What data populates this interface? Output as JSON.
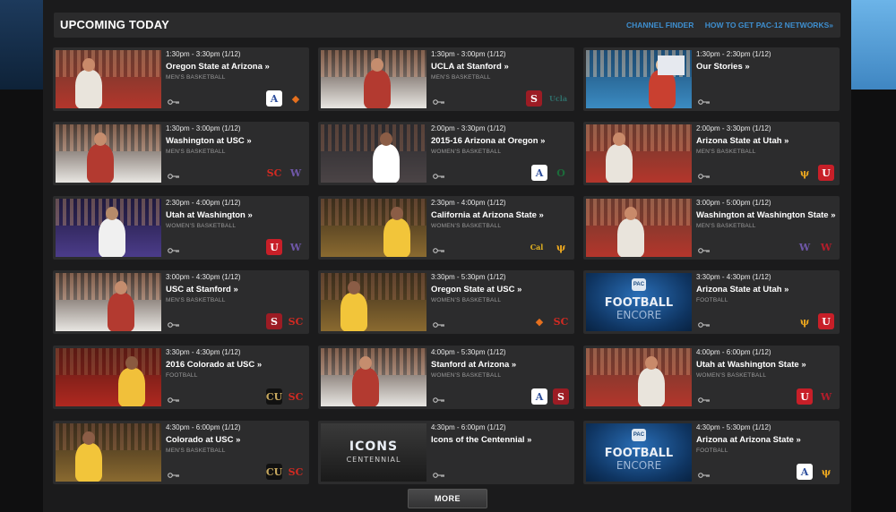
{
  "header": {
    "title": "UPCOMING TODAY",
    "link_channel_finder": "CHANNEL FINDER",
    "link_how_to_get": "HOW TO GET PAC-12 NETWORKS»"
  },
  "more_label": "MORE",
  "cards": [
    {
      "time": "1:30pm - 3:30pm (1/12)",
      "title": "Oregon State at Arizona »",
      "sport": "MEN'S BASKETBALL",
      "logos": [
        "arizona-logo",
        "oregon-state-logo"
      ],
      "thumb": "basketball-red"
    },
    {
      "time": "1:30pm - 3:00pm (1/12)",
      "title": "UCLA at Stanford »",
      "sport": "MEN'S BASKETBALL",
      "logos": [
        "stanford-logo",
        "ucla-logo"
      ],
      "thumb": "basketball-white"
    },
    {
      "time": "1:30pm - 2:30pm (1/12)",
      "title": "Our Stories »",
      "sport": "",
      "logos": [],
      "thumb": "studio"
    },
    {
      "time": "1:30pm - 3:00pm (1/12)",
      "title": "Washington at USC »",
      "sport": "MEN'S BASKETBALL",
      "logos": [
        "usc-logo",
        "washington-logo"
      ],
      "thumb": "basketball-white"
    },
    {
      "time": "2:00pm - 3:30pm (1/12)",
      "title": "2015-16 Arizona at Oregon »",
      "sport": "WOMEN'S BASKETBALL",
      "logos": [
        "arizona-logo",
        "oregon-logo"
      ],
      "thumb": "basketball-dark"
    },
    {
      "time": "2:00pm - 3:30pm (1/12)",
      "title": "Arizona State at Utah »",
      "sport": "MEN'S BASKETBALL",
      "logos": [
        "arizona-state-logo",
        "utah-logo"
      ],
      "thumb": "basketball-red"
    },
    {
      "time": "2:30pm - 4:00pm (1/12)",
      "title": "Utah at Washington »",
      "sport": "WOMEN'S BASKETBALL",
      "logos": [
        "utah-logo",
        "washington-logo"
      ],
      "thumb": "basketball-purple"
    },
    {
      "time": "2:30pm - 4:00pm (1/12)",
      "title": "California at Arizona State »",
      "sport": "WOMEN'S BASKETBALL",
      "logos": [
        "california-logo",
        "arizona-state-logo"
      ],
      "thumb": "basketball-gold"
    },
    {
      "time": "3:00pm - 5:00pm (1/12)",
      "title": "Washington at Washington State »",
      "sport": "MEN'S BASKETBALL",
      "logos": [
        "washington-logo",
        "washington-state-logo"
      ],
      "thumb": "basketball-red"
    },
    {
      "time": "3:00pm - 4:30pm (1/12)",
      "title": "USC at Stanford »",
      "sport": "MEN'S BASKETBALL",
      "logos": [
        "stanford-logo",
        "usc-logo"
      ],
      "thumb": "basketball-white"
    },
    {
      "time": "3:30pm - 5:30pm (1/12)",
      "title": "Oregon State at USC »",
      "sport": "WOMEN'S BASKETBALL",
      "logos": [
        "oregon-state-logo",
        "usc-logo"
      ],
      "thumb": "basketball-gold"
    },
    {
      "time": "3:30pm - 4:30pm (1/12)",
      "title": "Arizona State at Utah »",
      "sport": "FOOTBALL",
      "logos": [
        "arizona-state-logo",
        "utah-logo"
      ],
      "thumb": "football-encore"
    },
    {
      "time": "3:30pm - 4:30pm (1/12)",
      "title": "2016 Colorado at USC »",
      "sport": "FOOTBALL",
      "logos": [
        "colorado-logo",
        "usc-logo"
      ],
      "thumb": "football-red"
    },
    {
      "time": "4:00pm - 5:30pm (1/12)",
      "title": "Stanford at Arizona »",
      "sport": "WOMEN'S BASKETBALL",
      "logos": [
        "arizona-logo",
        "stanford-logo"
      ],
      "thumb": "basketball-white"
    },
    {
      "time": "4:00pm - 6:00pm (1/12)",
      "title": "Utah at Washington State »",
      "sport": "WOMEN'S BASKETBALL",
      "logos": [
        "utah-logo",
        "washington-state-logo"
      ],
      "thumb": "basketball-red"
    },
    {
      "time": "4:30pm - 6:00pm (1/12)",
      "title": "Colorado at USC »",
      "sport": "MEN'S BASKETBALL",
      "logos": [
        "colorado-logo",
        "usc-logo"
      ],
      "thumb": "basketball-gold"
    },
    {
      "time": "4:30pm - 6:00pm (1/12)",
      "title": "Icons of the Centennial »",
      "sport": "",
      "logos": [],
      "thumb": "icons-centennial"
    },
    {
      "time": "4:30pm - 5:30pm (1/12)",
      "title": "Arizona at Arizona State »",
      "sport": "FOOTBALL",
      "logos": [
        "arizona-logo",
        "arizona-state-logo"
      ],
      "thumb": "football-encore"
    }
  ],
  "logo_glyphs": {
    "arizona-logo": {
      "text": "A",
      "color": "#2b4d9c",
      "bg": "#ffffff"
    },
    "oregon-state-logo": {
      "text": "◆",
      "color": "#e6701e",
      "bg": "transparent"
    },
    "stanford-logo": {
      "text": "S",
      "color": "#ffffff",
      "bg": "#9c1c24"
    },
    "ucla-logo": {
      "text": "Ucla",
      "color": "#2f6e6a",
      "bg": "transparent"
    },
    "usc-logo": {
      "text": "SC",
      "color": "#d22a22",
      "bg": "transparent"
    },
    "washington-logo": {
      "text": "W",
      "color": "#6f57a8",
      "bg": "transparent"
    },
    "oregon-logo": {
      "text": "O",
      "color": "#1c6b3a",
      "bg": "transparent"
    },
    "arizona-state-logo": {
      "text": "ψ",
      "color": "#e8a51f",
      "bg": "transparent"
    },
    "utah-logo": {
      "text": "U",
      "color": "#ffffff",
      "bg": "#c81f28"
    },
    "california-logo": {
      "text": "Cal",
      "color": "#e5b420",
      "bg": "transparent"
    },
    "washington-state-logo": {
      "text": "W",
      "color": "#b31d2b",
      "bg": "transparent"
    },
    "colorado-logo": {
      "text": "CU",
      "color": "#c8a95f",
      "bg": "#111111"
    }
  },
  "thumb_text": {
    "football-encore": {
      "line1": "FOOTBALL",
      "line2": "ENCORE",
      "badge": "PAC"
    },
    "icons-centennial": {
      "line1": "ICONS",
      "line2": "CENTENNIAL",
      "badge": ""
    }
  }
}
